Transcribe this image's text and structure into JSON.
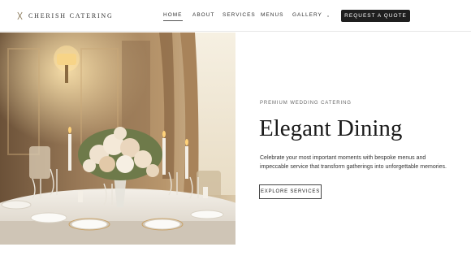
{
  "brand": {
    "name": "CHERISH CATERING",
    "icon": "crossed-utensils-icon"
  },
  "nav": {
    "items": [
      {
        "label": "HOME",
        "active": true
      },
      {
        "label": "ABOUT",
        "active": false
      },
      {
        "label": "SERVICES",
        "active": false
      },
      {
        "label": "MENUS",
        "active": false
      },
      {
        "label": "GALLERY",
        "active": false
      }
    ],
    "cta_label": "REQUEST A QUOTE"
  },
  "hero": {
    "image_subject": "elegant wedding banquet table with floral centerpiece and candles",
    "eyebrow": "PREMIUM WEDDING CATERING",
    "title": "Elegant Dining",
    "description": "Celebrate your most important moments with bespoke menus and impeccable service that transform gatherings into unforgettable memories.",
    "button_label": "EXPLORE SERVICES"
  },
  "colors": {
    "cta_bg": "#1f1f1f",
    "text": "#1a1a1a",
    "accent_gold": "#c9a36b"
  }
}
